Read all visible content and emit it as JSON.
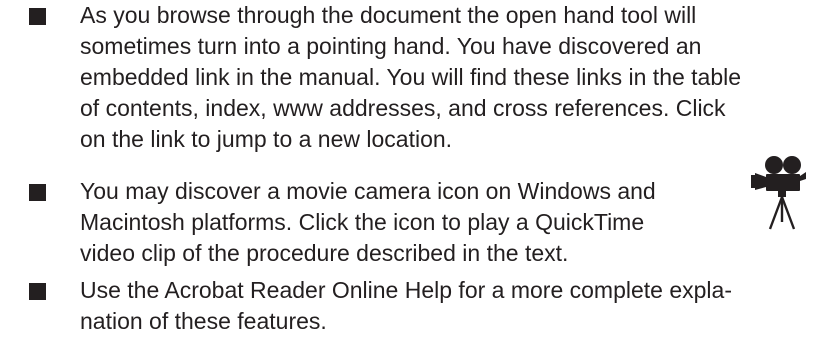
{
  "items": [
    {
      "text": "As you browse through the document the open hand tool will\nsometimes turn into a pointing hand. You have discovered an\nembedded link in the manual. You will find these links in the table\nof contents, index, www addresses, and cross references. Click\non the link to jump to a new location."
    },
    {
      "text": "You may discover a movie camera icon on Windows and\nMacintosh platforms. Click the icon to play a QuickTime\nvideo clip of the procedure described in the text.",
      "icon": "movie-camera-icon"
    },
    {
      "text": "Use the Acrobat Reader Online Help for a more complete expla-\nnation of these features."
    }
  ],
  "colors": {
    "text": "#231f20",
    "bullet": "#231f20",
    "background": "#ffffff"
  }
}
